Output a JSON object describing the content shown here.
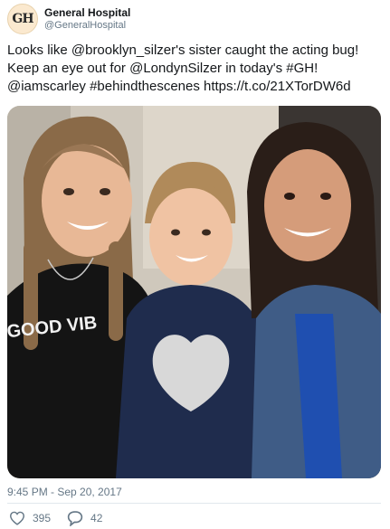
{
  "account": {
    "display_name": "General Hospital",
    "handle": "@GeneralHospital",
    "avatar_text": "GH"
  },
  "tweet": {
    "lines": [
      "Looks like @brooklyn_silzer's sister caught the acting bug!",
      "Keep an eye out for @LondynSilzer in today's #GH!",
      "@iamscarley #behindthescenes https://t.co/21XTorDW6d"
    ],
    "media_icon": "photo",
    "shirt_text": "GOOD VIB",
    "timestamp": "9:45 PM - Sep 20, 2017"
  },
  "actions": {
    "likes": "395",
    "replies": "42",
    "like_icon": "heart-icon",
    "reply_icon": "speech-bubble-icon"
  },
  "colors": {
    "text": "#14171a",
    "secondary": "#657786",
    "divider": "#e1e8ed"
  }
}
